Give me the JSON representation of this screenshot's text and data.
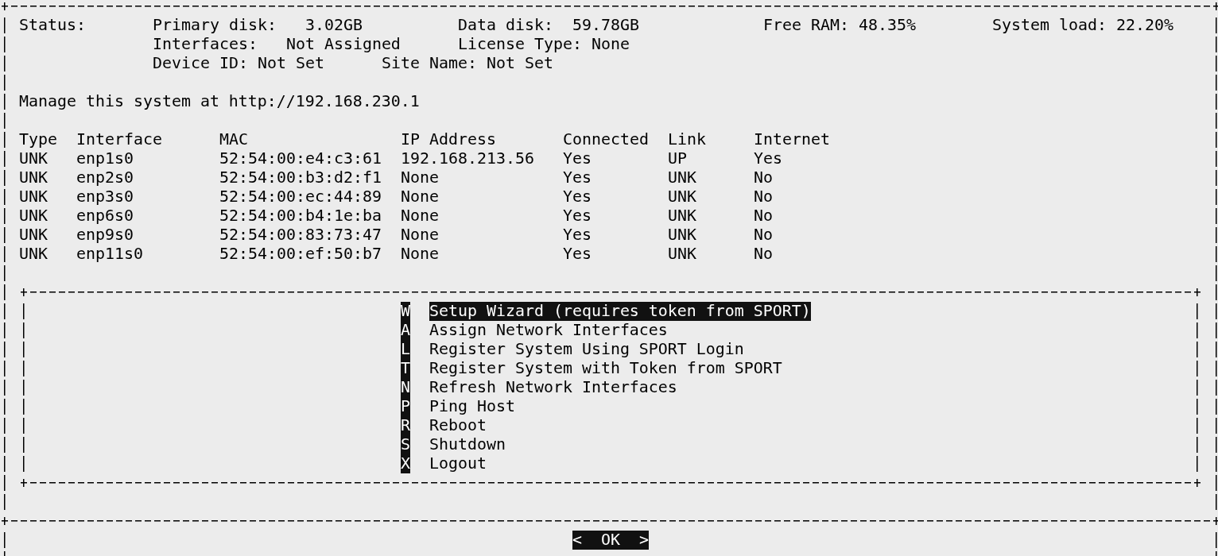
{
  "status": {
    "title": "Status:",
    "lines": [
      [
        {
          "label": "Primary disk:",
          "value": "3.02GB"
        },
        {
          "label": "Data disk:",
          "value": "59.78GB"
        },
        {
          "label": "Free RAM:",
          "value": "48.35%"
        },
        {
          "label": "System load:",
          "value": "22.20%"
        }
      ],
      [
        {
          "label": "Interfaces:",
          "value": "Not Assigned"
        },
        {
          "label": "License Type:",
          "value": "None"
        }
      ],
      [
        {
          "label": "Device ID:",
          "value": "Not Set"
        },
        {
          "label": "Site Name:",
          "value": "Not Set"
        }
      ]
    ]
  },
  "manage_text": "Manage this system at http://192.168.230.1",
  "table": {
    "columns": [
      "Type",
      "Interface",
      "MAC",
      "IP Address",
      "Connected",
      "Link",
      "Internet"
    ],
    "rows": [
      [
        "UNK",
        "enp1s0",
        "52:54:00:e4:c3:61",
        "192.168.213.56",
        "Yes",
        "UP",
        "Yes"
      ],
      [
        "UNK",
        "enp2s0",
        "52:54:00:b3:d2:f1",
        "None",
        "Yes",
        "UNK",
        "No"
      ],
      [
        "UNK",
        "enp3s0",
        "52:54:00:ec:44:89",
        "None",
        "Yes",
        "UNK",
        "No"
      ],
      [
        "UNK",
        "enp6s0",
        "52:54:00:b4:1e:ba",
        "None",
        "Yes",
        "UNK",
        "No"
      ],
      [
        "UNK",
        "enp9s0",
        "52:54:00:83:73:47",
        "None",
        "Yes",
        "UNK",
        "No"
      ],
      [
        "UNK",
        "enp11s0",
        "52:54:00:ef:50:b7",
        "None",
        "Yes",
        "UNK",
        "No"
      ]
    ]
  },
  "menu": {
    "items": [
      {
        "key": "W",
        "label": "Setup Wizard (requires token from SPORT)",
        "selected": true
      },
      {
        "key": "A",
        "label": "Assign Network Interfaces",
        "selected": false
      },
      {
        "key": "L",
        "label": "Register System Using SPORT Login",
        "selected": false
      },
      {
        "key": "T",
        "label": "Register System with Token from SPORT",
        "selected": false
      },
      {
        "key": "N",
        "label": "Refresh Network Interfaces",
        "selected": false
      },
      {
        "key": "P",
        "label": "Ping Host",
        "selected": false
      },
      {
        "key": "R",
        "label": "Reboot",
        "selected": false
      },
      {
        "key": "S",
        "label": "Shutdown",
        "selected": false
      },
      {
        "key": "X",
        "label": "Logout",
        "selected": false
      }
    ]
  },
  "buttons": [
    {
      "label": "<  OK  >",
      "selected": true
    }
  ]
}
